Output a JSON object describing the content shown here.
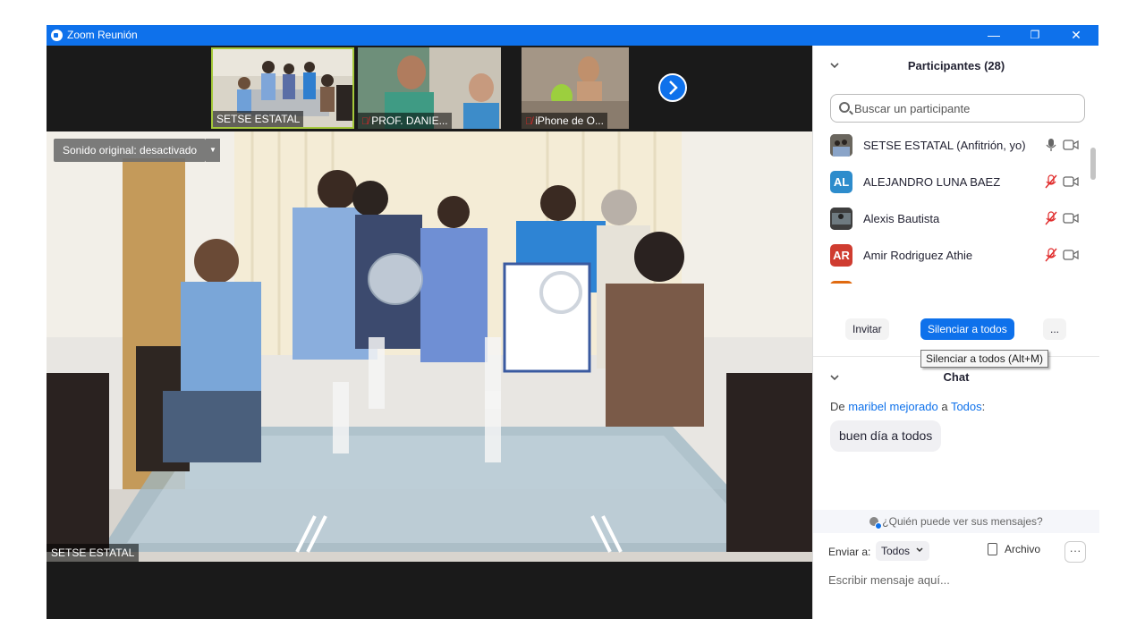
{
  "window": {
    "title": "Zoom Reunión",
    "minimize_glyph": "—",
    "restore_glyph": "❐",
    "close_glyph": "✕"
  },
  "colors": {
    "accent": "#0e71eb",
    "mute": "#e02828",
    "stage_bg": "#1a1a1a"
  },
  "video_strip": [
    {
      "name": "SETSE ESTATAL",
      "muted": false,
      "active": true
    },
    {
      "name": "PROF. DANIE...",
      "muted": true,
      "active": false
    },
    {
      "name": "iPhone de O...",
      "muted": true,
      "active": false
    }
  ],
  "strip_next_icon": "chevron-right-icon",
  "main_video": {
    "sound_original": "Sonido original: desactivado",
    "speaker_name": "SETSE ESTATAL"
  },
  "participants": {
    "title": "Participantes (28)",
    "search_placeholder": "Buscar un participante",
    "list": [
      {
        "name": "SETSE ESTATAL (Anfitrión, yo)",
        "avatar": "photo",
        "color": "#4a4a4a",
        "mic": "on"
      },
      {
        "name": "ALEJANDRO LUNA BAEZ",
        "avatar": "AL",
        "color": "#2d8ccc",
        "mic": "muted"
      },
      {
        "name": "Alexis Bautista",
        "avatar": "photo",
        "color": "#555555",
        "mic": "muted"
      },
      {
        "name": "Amir Rodriguez Athie",
        "avatar": "AR",
        "color": "#cf3c30",
        "mic": "muted"
      }
    ],
    "invite_label": "Invitar",
    "mute_all_label": "Silenciar a todos",
    "more_label": "...",
    "tooltip": "Silenciar a todos (Alt+M)"
  },
  "chat": {
    "title": "Chat",
    "from_prefix": "De",
    "from_user": "maribel mejorado",
    "to_word": "a",
    "to_target": "Todos",
    "colon": ":",
    "message": "buen día a todos",
    "who_can_see": "¿Quién puede ver sus mensajes?",
    "send_to_label": "Enviar a:",
    "send_to_value": "Todos",
    "file_label": "Archivo",
    "more_label": "···",
    "input_placeholder": "Escribir mensaje aquí..."
  }
}
